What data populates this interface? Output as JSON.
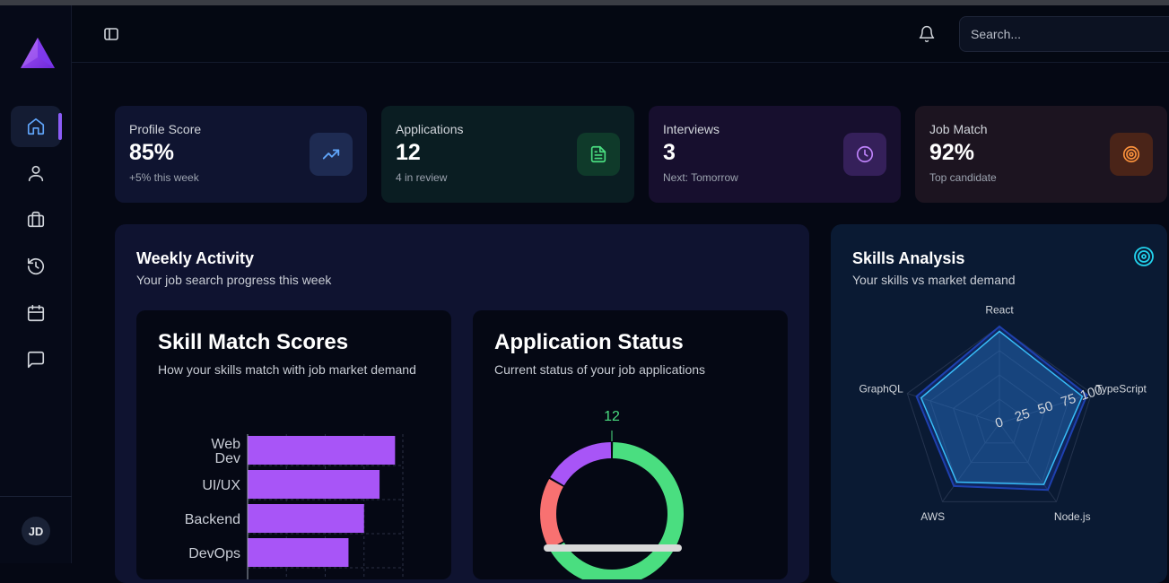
{
  "header": {
    "search_placeholder": "Search..."
  },
  "user": {
    "initials": "JD"
  },
  "sidebar": {
    "items": [
      "home-icon",
      "user-icon",
      "briefcase-icon",
      "history-icon",
      "calendar-icon",
      "message-icon"
    ],
    "active": "home-icon"
  },
  "stats": [
    {
      "label": "Profile Score",
      "value": "85%",
      "sub": "+5% this week",
      "icon": "trending-up-icon",
      "accent": "#60a5fa"
    },
    {
      "label": "Applications",
      "value": "12",
      "sub": "4 in review",
      "icon": "document-icon",
      "accent": "#4ade80"
    },
    {
      "label": "Interviews",
      "value": "3",
      "sub": "Next: Tomorrow",
      "icon": "clock-icon",
      "accent": "#c084fc"
    },
    {
      "label": "Job Match",
      "value": "92%",
      "sub": "Top candidate",
      "icon": "target-icon",
      "accent": "#fb923c"
    }
  ],
  "weekly": {
    "title": "Weekly Activity",
    "subtitle": "Your job search progress this week",
    "skill_card": {
      "title": "Skill Match Scores",
      "subtitle": "How your skills match with job market demand"
    },
    "status_card": {
      "title": "Application Status",
      "subtitle": "Current status of your job applications"
    }
  },
  "skills": {
    "title": "Skills Analysis",
    "subtitle": "Your skills vs market demand"
  },
  "chart_data": [
    {
      "type": "bar",
      "orientation": "horizontal",
      "title": "Skill Match Scores",
      "categories": [
        "Web Dev",
        "UI/UX",
        "Backend",
        "DevOps"
      ],
      "values": [
        95,
        85,
        75,
        65
      ],
      "xlim": [
        0,
        100
      ],
      "color": "#a855f7",
      "grid": true
    },
    {
      "type": "pie",
      "style": "donut",
      "title": "Application Status",
      "slices": [
        {
          "value": 12,
          "color": "#4ade80",
          "label": "12"
        },
        {
          "value": 3,
          "color": "#f87171"
        },
        {
          "value": 3,
          "color": "#a855f7"
        }
      ]
    },
    {
      "type": "radar",
      "title": "Skills Analysis",
      "axes": [
        "React",
        "TypeScript",
        "Node.js",
        "AWS",
        "GraphQL"
      ],
      "ticks": [
        "0",
        "25",
        "50",
        "75",
        "100"
      ],
      "ylim": [
        0,
        100
      ],
      "series": [
        {
          "values": [
            100,
            95,
            85,
            80,
            90
          ],
          "color": "#1e40af"
        },
        {
          "values": [
            95,
            90,
            78,
            75,
            85
          ],
          "color": "#38bdf8"
        }
      ]
    }
  ]
}
